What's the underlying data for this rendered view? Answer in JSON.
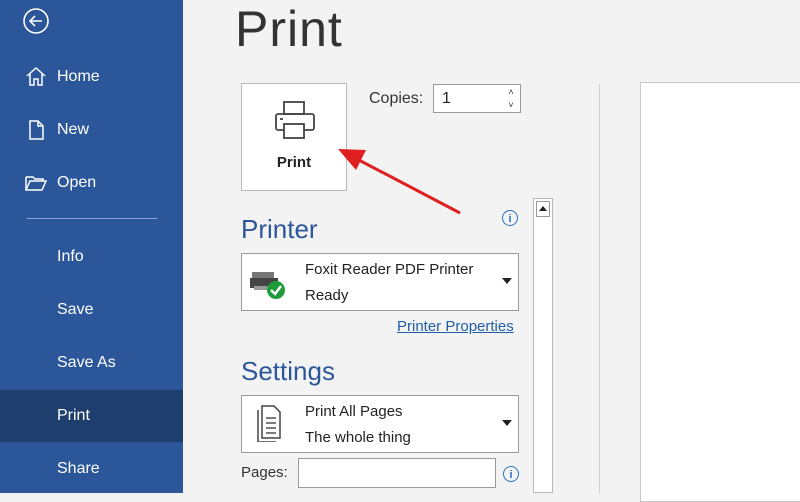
{
  "sidebar": {
    "items": [
      {
        "label": "Home",
        "icon": "home-icon"
      },
      {
        "label": "New",
        "icon": "new-document-icon"
      },
      {
        "label": "Open",
        "icon": "folder-open-icon"
      },
      {
        "label": "Info"
      },
      {
        "label": "Save"
      },
      {
        "label": "Save As"
      },
      {
        "label": "Print",
        "active": true
      },
      {
        "label": "Share"
      }
    ]
  },
  "main": {
    "title": "Print",
    "print_button_label": "Print",
    "copies_label": "Copies:",
    "copies_value": "1",
    "printer_heading": "Printer",
    "printer": {
      "name": "Foxit Reader PDF Printer",
      "status": "Ready"
    },
    "printer_properties_link": "Printer Properties",
    "settings_heading": "Settings",
    "settings": {
      "line1": "Print All Pages",
      "line2": "The whole thing"
    },
    "pages_label": "Pages:",
    "pages_value": ""
  },
  "colors": {
    "sidebar": "#2b579a",
    "sidebar_active": "#1e3e6e",
    "accent": "#2b579a",
    "annotation_arrow": "#e02020"
  }
}
